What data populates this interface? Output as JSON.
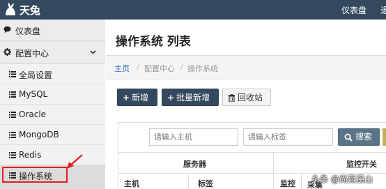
{
  "topbar": {
    "brand": "天兔",
    "nav_dashboard": "仪表盘",
    "nav_cut": "退"
  },
  "sidebar": {
    "dashboard": "仪表盘",
    "config_center": "配置中心",
    "sub_items": [
      "全局设置",
      "MySQL",
      "Oracle",
      "MongoDB",
      "Redis",
      "操作系统"
    ]
  },
  "main": {
    "page_title": "操作系统 列表",
    "breadcrumb": {
      "home": "主页",
      "sep": "/",
      "level2": "配置中心",
      "level3": "操作系统"
    },
    "buttons": {
      "add": "新增",
      "batch_add": "批量新增",
      "recycle": "回收站"
    },
    "search": {
      "host_placeholder": "请输入主机",
      "tag_placeholder": "请输入标签",
      "search_label": "搜索"
    },
    "table": {
      "group_server": "服务器",
      "group_monitor": "监控开关",
      "col_host": "主机",
      "col_tag": "标签",
      "col_monitor": "监控",
      "col_cut": "采集"
    }
  },
  "watermark": "头条 @尚熹溪山",
  "colors": {
    "topbar": "#34495e",
    "link": "#2a6fb5",
    "primary_button": "#34495e",
    "search_button": "#5a7487",
    "annotation_red": "#e02020"
  }
}
